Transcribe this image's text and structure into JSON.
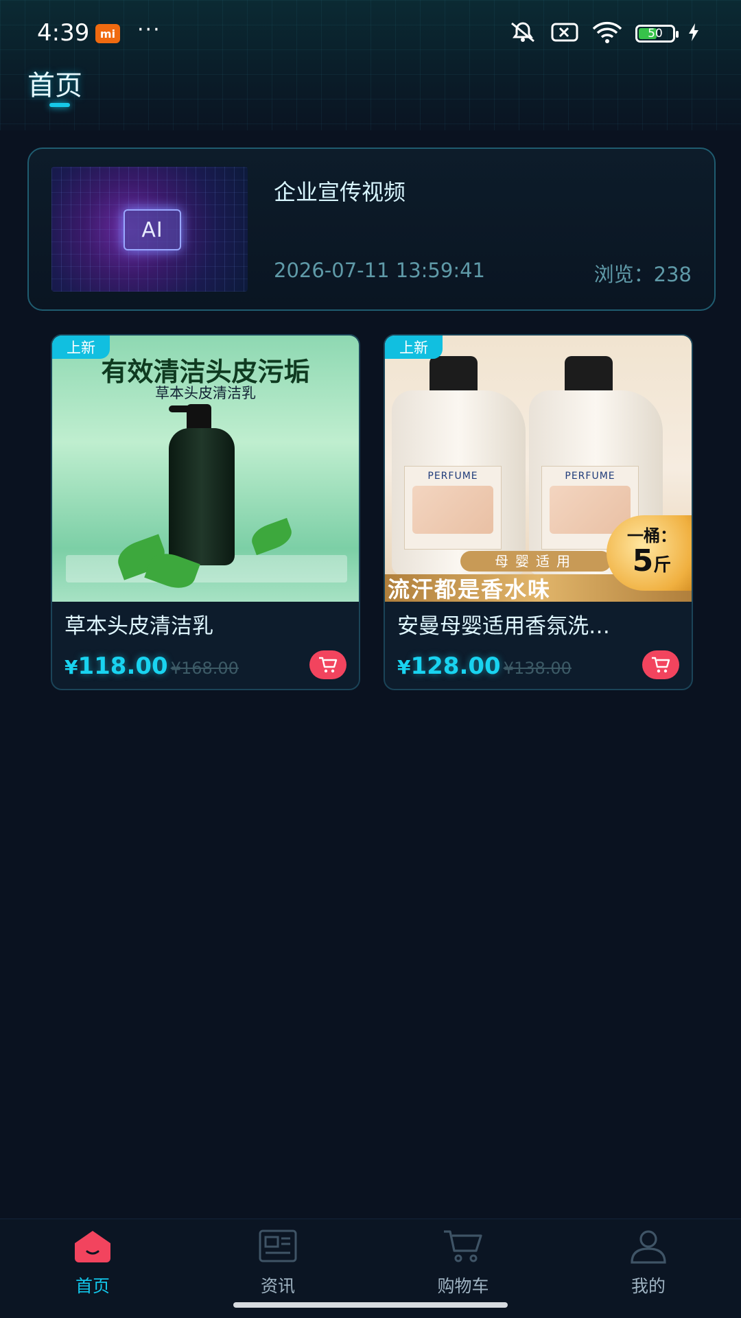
{
  "status_bar": {
    "time": "4:39",
    "brand_badge": "mi",
    "more": "···",
    "battery_level": "50"
  },
  "header": {
    "title": "首页"
  },
  "video_card": {
    "title": "企业宣传视频",
    "thumbnail_text": "AI",
    "date": "2026-07-11 13:59:41",
    "views": "浏览：238"
  },
  "products": [
    {
      "badge": "上新",
      "image_headline": "有效清洁头皮污垢",
      "image_subline": "草本头皮清洁乳",
      "name": "草本头皮清洁乳",
      "price_symbol": "¥",
      "price": "118.00",
      "original_price": "¥168.00"
    },
    {
      "badge": "上新",
      "image_label": "PERFUME",
      "image_banner": "流汗都是香水味",
      "image_strip": "母婴适用",
      "seal_top": "一桶：",
      "seal_num": "5",
      "seal_unit": "斤",
      "name": "安曼母婴适用香氛洗…",
      "price_symbol": "¥",
      "price": "128.00",
      "original_price": "¥138.00"
    }
  ],
  "bottom_nav": {
    "items": [
      {
        "label": "首页",
        "icon": "home-icon",
        "active": true
      },
      {
        "label": "资讯",
        "icon": "news-icon",
        "active": false
      },
      {
        "label": "购物车",
        "icon": "cart-icon",
        "active": false
      },
      {
        "label": "我的",
        "icon": "profile-icon",
        "active": false
      }
    ]
  },
  "colors": {
    "accent": "#12c6ea",
    "cart_button": "#f2445e",
    "home_icon": "#f2445e",
    "background": "#0a1220"
  }
}
